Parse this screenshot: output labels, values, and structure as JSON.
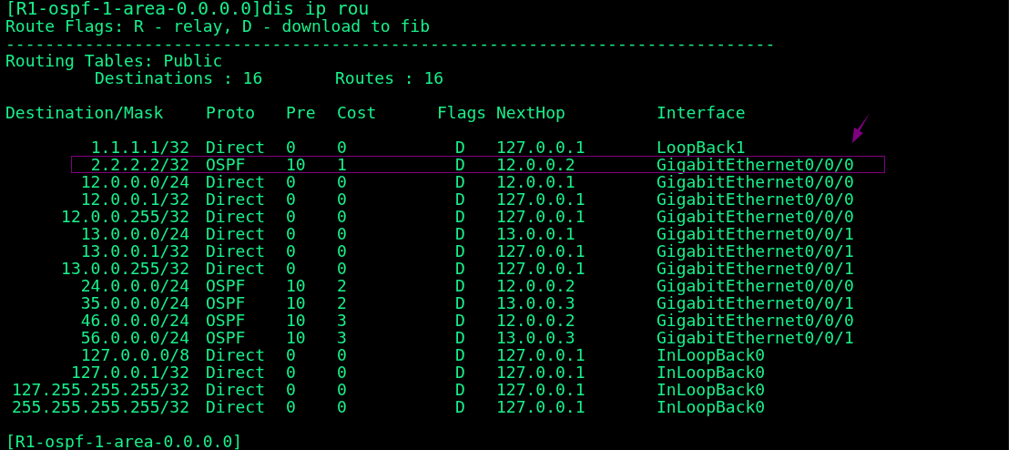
{
  "command_line": "[R1-ospf-1-area-0.0.0.0]dis ip rou",
  "flags_legend": "Route Flags: R - relay, D - download to fib",
  "separator": "------------------------------------------------------------------------------",
  "table_title": "Routing Tables: Public",
  "destinations": "Destinations : 16",
  "routes": "Routes : 16",
  "columns": [
    "Destination/Mask",
    "Proto",
    "Pre",
    "Cost",
    "Flags",
    "NextHop",
    "Interface"
  ],
  "rows": [
    {
      "destination": "1.1.1.1/32",
      "proto": "Direct",
      "pre": "0",
      "cost": "0",
      "flags": "D",
      "nexthop": "127.0.0.1",
      "interface": "LoopBack1",
      "highlighted": false
    },
    {
      "destination": "2.2.2.2/32",
      "proto": "OSPF",
      "pre": "10",
      "cost": "1",
      "flags": "D",
      "nexthop": "12.0.0.2",
      "interface": "GigabitEthernet0/0/0",
      "highlighted": true
    },
    {
      "destination": "12.0.0.0/24",
      "proto": "Direct",
      "pre": "0",
      "cost": "0",
      "flags": "D",
      "nexthop": "12.0.0.1",
      "interface": "GigabitEthernet0/0/0",
      "highlighted": false
    },
    {
      "destination": "12.0.0.1/32",
      "proto": "Direct",
      "pre": "0",
      "cost": "0",
      "flags": "D",
      "nexthop": "127.0.0.1",
      "interface": "GigabitEthernet0/0/0",
      "highlighted": false
    },
    {
      "destination": "12.0.0.255/32",
      "proto": "Direct",
      "pre": "0",
      "cost": "0",
      "flags": "D",
      "nexthop": "127.0.0.1",
      "interface": "GigabitEthernet0/0/0",
      "highlighted": false
    },
    {
      "destination": "13.0.0.0/24",
      "proto": "Direct",
      "pre": "0",
      "cost": "0",
      "flags": "D",
      "nexthop": "13.0.0.1",
      "interface": "GigabitEthernet0/0/1",
      "highlighted": false
    },
    {
      "destination": "13.0.0.1/32",
      "proto": "Direct",
      "pre": "0",
      "cost": "0",
      "flags": "D",
      "nexthop": "127.0.0.1",
      "interface": "GigabitEthernet0/0/1",
      "highlighted": false
    },
    {
      "destination": "13.0.0.255/32",
      "proto": "Direct",
      "pre": "0",
      "cost": "0",
      "flags": "D",
      "nexthop": "127.0.0.1",
      "interface": "GigabitEthernet0/0/1",
      "highlighted": false
    },
    {
      "destination": "24.0.0.0/24",
      "proto": "OSPF",
      "pre": "10",
      "cost": "2",
      "flags": "D",
      "nexthop": "12.0.0.2",
      "interface": "GigabitEthernet0/0/0",
      "highlighted": false
    },
    {
      "destination": "35.0.0.0/24",
      "proto": "OSPF",
      "pre": "10",
      "cost": "2",
      "flags": "D",
      "nexthop": "13.0.0.3",
      "interface": "GigabitEthernet0/0/1",
      "highlighted": false
    },
    {
      "destination": "46.0.0.0/24",
      "proto": "OSPF",
      "pre": "10",
      "cost": "3",
      "flags": "D",
      "nexthop": "12.0.0.2",
      "interface": "GigabitEthernet0/0/0",
      "highlighted": false
    },
    {
      "destination": "56.0.0.0/24",
      "proto": "OSPF",
      "pre": "10",
      "cost": "3",
      "flags": "D",
      "nexthop": "13.0.0.3",
      "interface": "GigabitEthernet0/0/1",
      "highlighted": false
    },
    {
      "destination": "127.0.0.0/8",
      "proto": "Direct",
      "pre": "0",
      "cost": "0",
      "flags": "D",
      "nexthop": "127.0.0.1",
      "interface": "InLoopBack0",
      "highlighted": false
    },
    {
      "destination": "127.0.0.1/32",
      "proto": "Direct",
      "pre": "0",
      "cost": "0",
      "flags": "D",
      "nexthop": "127.0.0.1",
      "interface": "InLoopBack0",
      "highlighted": false
    },
    {
      "destination": "127.255.255.255/32",
      "proto": "Direct",
      "pre": "0",
      "cost": "0",
      "flags": "D",
      "nexthop": "127.0.0.1",
      "interface": "InLoopBack0",
      "highlighted": false
    },
    {
      "destination": "255.255.255.255/32",
      "proto": "Direct",
      "pre": "0",
      "cost": "0",
      "flags": "D",
      "nexthop": "127.0.0.1",
      "interface": "InLoopBack0",
      "highlighted": false
    }
  ],
  "prompt": "[R1-ospf-1-area-0.0.0.0]"
}
